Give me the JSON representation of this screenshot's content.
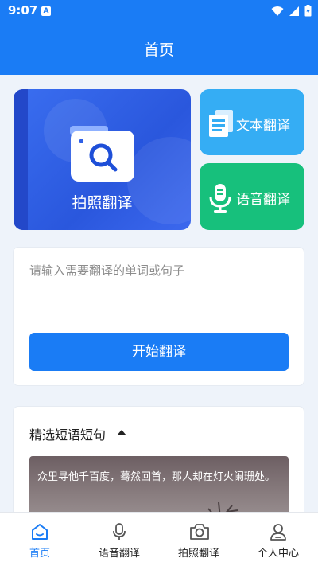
{
  "status": {
    "time": "9:07",
    "notif": "A"
  },
  "header": {
    "title": "首页"
  },
  "features": {
    "photo": {
      "label": "拍照翻译"
    },
    "text": {
      "label": "文本翻译"
    },
    "voice": {
      "label": "语音翻译"
    }
  },
  "translate": {
    "placeholder": "请输入需要翻译的单词或句子",
    "value": "",
    "button": "开始翻译"
  },
  "phrases": {
    "title": "精选短语短句",
    "items": [
      {
        "text": "众里寻他千百度，蓦然回首，那人却在灯火阑珊处。"
      }
    ]
  },
  "tabs": [
    {
      "label": "首页",
      "icon": "home-icon",
      "active": true
    },
    {
      "label": "语音翻译",
      "icon": "microphone-icon",
      "active": false
    },
    {
      "label": "拍照翻译",
      "icon": "camera-icon",
      "active": false
    },
    {
      "label": "个人中心",
      "icon": "user-icon",
      "active": false
    }
  ],
  "colors": {
    "primary": "#1a7cf5",
    "photo_card": "#2f60e6",
    "text_card": "#35adf4",
    "voice_card": "#17c07c"
  }
}
